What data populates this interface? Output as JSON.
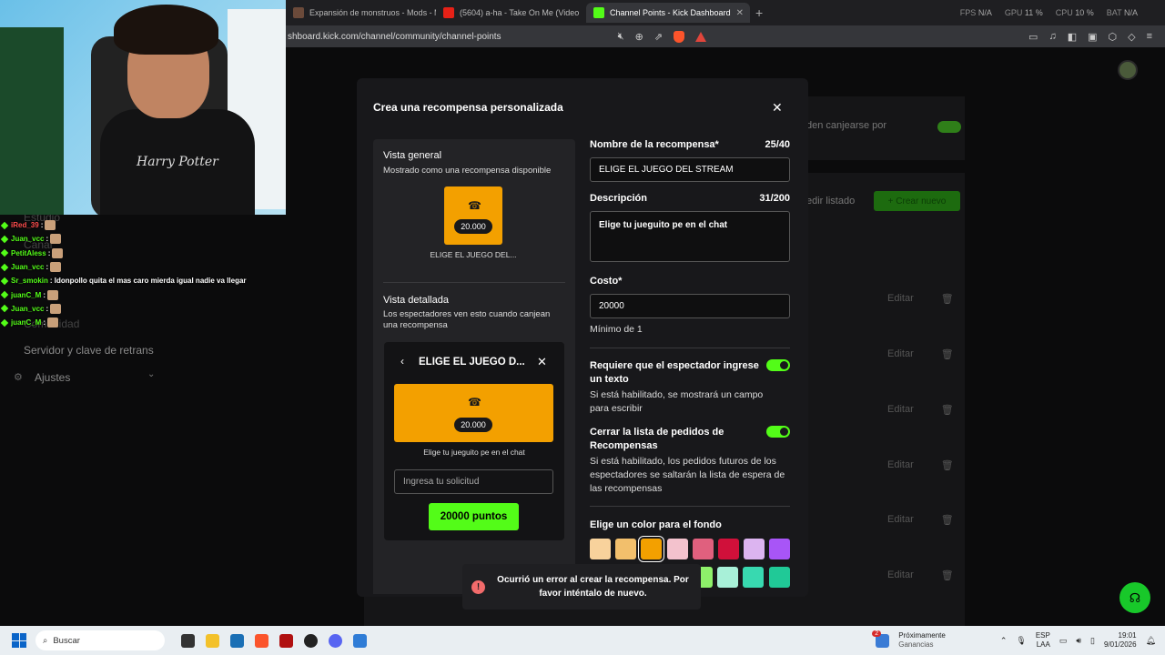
{
  "browser": {
    "tabs": [
      {
        "label": "Expansión de monstruos - Mods - M",
        "fav_color": "#6b4a3a"
      },
      {
        "label": "(5604) a-ha - Take On Me (Video",
        "fav_color": "#e62117"
      },
      {
        "label": "Channel Points - Kick Dashboard",
        "fav_color": "#53fc18"
      }
    ],
    "url": "shboard.kick.com/channel/community/channel-points",
    "stats": {
      "fps_label": "FPS",
      "fps": "N/A",
      "gpu_label": "GPU",
      "gpu": "11 %",
      "cpu_label": "CPU",
      "cpu": "10 %",
      "bat_label": "BAT",
      "bat": "N/A"
    }
  },
  "background": {
    "sidebar": [
      "Estudio",
      "Canal",
      "Comunidad",
      "Servidor y clave de retrans",
      "Ajustes"
    ],
    "top_text": "den canjearse por",
    "list_label": "edir listado",
    "create_button": "+ Crear nuevo",
    "edit_label": "Editar"
  },
  "chat": [
    {
      "user": "iRed_39",
      "color": "#ff4d4d",
      "msg": ":"
    },
    {
      "user": "Juan_vcc",
      "color": "#53fc18",
      "msg": ":"
    },
    {
      "user": "PetitAless",
      "color": "#53fc18",
      "msg": ":"
    },
    {
      "user": "Juan_vcc",
      "color": "#53fc18",
      "msg": ":"
    },
    {
      "user": "Sr_smokin",
      "color": "#53fc18",
      "msg": ": Idonpollo quita el mas caro mierda igual nadie va llegar"
    },
    {
      "user": "juanC_M",
      "color": "#53fc18",
      "msg": ":"
    },
    {
      "user": "Juan_vcc",
      "color": "#53fc18",
      "msg": ":"
    },
    {
      "user": "juanC_M",
      "color": "#53fc18",
      "msg": ":"
    }
  ],
  "webcam": {
    "shirt_text": "Harry Potter"
  },
  "modal": {
    "title": "Crea una recompensa personalizada",
    "overview": {
      "heading": "Vista general",
      "subtitle": "Mostrado como una recompensa disponible",
      "cost": "20.000",
      "caption": "ELIGE EL JUEGO DEL..."
    },
    "detail": {
      "heading": "Vista detallada",
      "subtitle": "Los espectadores ven esto cuando canjean una recompensa",
      "title": "ELIGE EL JUEGO D...",
      "cost": "20.000",
      "description": "Elige tu jueguito pe en el chat",
      "input_placeholder": "Ingresa tu solicitud",
      "button": "20000 puntos"
    },
    "form": {
      "name_label": "Nombre de la recompensa*",
      "name_count": "25/40",
      "name_value": "ELIGE EL JUEGO DEL STREAM",
      "desc_label": "Descripción",
      "desc_count": "31/200",
      "desc_value": "Elige tu jueguito pe en el chat",
      "cost_label": "Costo*",
      "cost_value": "20000",
      "cost_min": "Mínimo de 1",
      "req_text_label": "Requiere que el espectador ingrese un texto",
      "req_text_help": "Si está habilitado, se mostrará un campo para escribir",
      "close_list_label": "Cerrar la lista de pedidos de Recompensas",
      "close_list_help": "Si está habilitado, los pedidos futuros de los espectadores se saltarán la lista de espera de las recompensas",
      "color_label": "Elige un color para el fondo",
      "colors": [
        "#f8d29c",
        "#f2bf6c",
        "#f3a000",
        "#f3c2cd",
        "#e0607e",
        "#d0103a",
        "#dcb4f0",
        "#a855f7"
      ],
      "colors_row2": [
        "#8ef06a",
        "#a8f0d8",
        "#38d9b0",
        "#20c997"
      ]
    }
  },
  "toast": {
    "message": "Ocurrió un error al crear la recompensa. Por favor inténtalo de nuevo."
  },
  "taskbar": {
    "search": "Buscar",
    "notif_title": "Próximamente",
    "notif_sub": "Ganancias",
    "notif_count": "2",
    "lang": "ESP",
    "lang2": "LAA",
    "time": "19:01",
    "date": "9/01/2026"
  }
}
